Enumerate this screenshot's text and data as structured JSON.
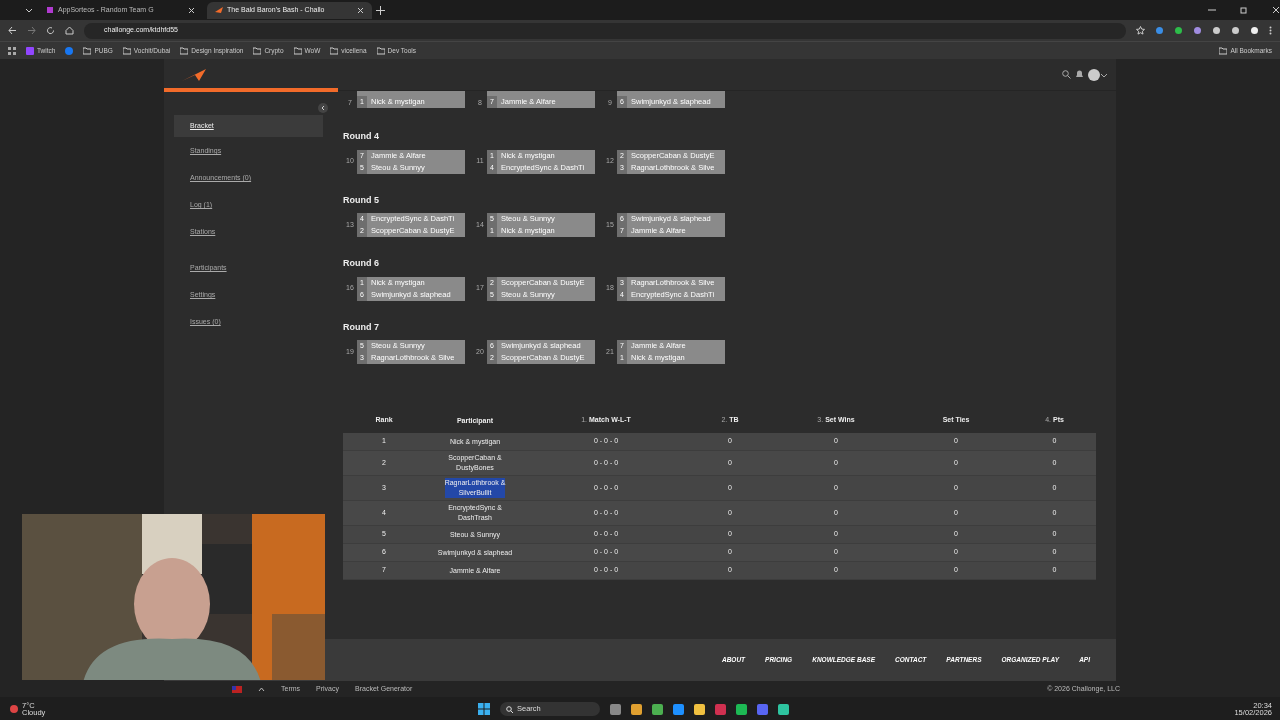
{
  "browser": {
    "tabs": [
      {
        "label": "AppSorteos - Random Team G",
        "selected": false
      },
      {
        "label": "The Bald Baron's Bash - Challo",
        "selected": true
      }
    ],
    "url": "challonge.com/ktdhfd55",
    "bookmarks": [
      {
        "label": "Twitch",
        "kind": "twitch"
      },
      {
        "kind": "facebook"
      },
      {
        "label": "PUBG",
        "kind": "folder"
      },
      {
        "label": "Vochit/Dubai",
        "kind": "folder"
      },
      {
        "label": "Design Inspiration",
        "kind": "folder"
      },
      {
        "label": "Crypto",
        "kind": "folder"
      },
      {
        "label": "WoW",
        "kind": "folder"
      },
      {
        "label": "vicellena",
        "kind": "folder"
      },
      {
        "label": "Dev Tools",
        "kind": "folder"
      }
    ],
    "all_bookmarks": "All Bookmarks"
  },
  "sidebar": {
    "items": [
      {
        "label": "Bracket",
        "selected": true
      },
      {
        "label": "Standings",
        "selected": false
      },
      {
        "label": "Announcements (0)",
        "selected": false
      },
      {
        "label": "Log (1)",
        "selected": false
      },
      {
        "label": "Stations",
        "selected": false
      },
      {
        "label": "Participants",
        "selected": false
      },
      {
        "label": "Settings",
        "selected": false
      },
      {
        "label": "Issues (0)",
        "selected": false
      }
    ]
  },
  "partial_round": {
    "matches": [
      {
        "number": "7",
        "seed": "1",
        "player": "Nick & mystigan"
      },
      {
        "number": "8",
        "seed": "7",
        "player": "Jammie & Alfare"
      },
      {
        "number": "9",
        "seed": "6",
        "player": "Swimjunkyd & slaphead"
      }
    ]
  },
  "rounds": [
    {
      "title": "Round 4",
      "matches": [
        {
          "number": "10",
          "players": [
            {
              "seed": "7",
              "name": "Jammie & Alfare"
            },
            {
              "seed": "5",
              "name": "Steou & Sunnyy"
            }
          ]
        },
        {
          "number": "11",
          "players": [
            {
              "seed": "1",
              "name": "Nick & mystigan"
            },
            {
              "seed": "4",
              "name": "EncryptedSync & DashTi"
            }
          ]
        },
        {
          "number": "12",
          "players": [
            {
              "seed": "2",
              "name": "ScopperCaban & DustyE"
            },
            {
              "seed": "3",
              "name": "RagnarLothbrook & Silve"
            }
          ]
        }
      ]
    },
    {
      "title": "Round 5",
      "matches": [
        {
          "number": "13",
          "players": [
            {
              "seed": "4",
              "name": "EncryptedSync & DashTi"
            },
            {
              "seed": "2",
              "name": "ScopperCaban & DustyE"
            }
          ]
        },
        {
          "number": "14",
          "players": [
            {
              "seed": "5",
              "name": "Steou & Sunnyy"
            },
            {
              "seed": "1",
              "name": "Nick & mystigan"
            }
          ]
        },
        {
          "number": "15",
          "players": [
            {
              "seed": "6",
              "name": "Swimjunkyd & slaphead"
            },
            {
              "seed": "7",
              "name": "Jammie & Alfare"
            }
          ]
        }
      ]
    },
    {
      "title": "Round 6",
      "matches": [
        {
          "number": "16",
          "players": [
            {
              "seed": "1",
              "name": "Nick & mystigan"
            },
            {
              "seed": "6",
              "name": "Swimjunkyd & slaphead"
            }
          ]
        },
        {
          "number": "17",
          "players": [
            {
              "seed": "2",
              "name": "ScopperCaban & DustyE"
            },
            {
              "seed": "5",
              "name": "Steou & Sunnyy"
            }
          ]
        },
        {
          "number": "18",
          "players": [
            {
              "seed": "3",
              "name": "RagnarLothbrook & Silve"
            },
            {
              "seed": "4",
              "name": "EncryptedSync & DashTi"
            }
          ]
        }
      ]
    },
    {
      "title": "Round 7",
      "matches": [
        {
          "number": "19",
          "players": [
            {
              "seed": "5",
              "name": "Steou & Sunnyy"
            },
            {
              "seed": "3",
              "name": "RagnarLothbrook & Silve"
            }
          ]
        },
        {
          "number": "20",
          "players": [
            {
              "seed": "6",
              "name": "Swimjunkyd & slaphead"
            },
            {
              "seed": "2",
              "name": "ScopperCaban & DustyE"
            }
          ]
        },
        {
          "number": "21",
          "players": [
            {
              "seed": "7",
              "name": "Jammie & Alfare"
            },
            {
              "seed": "1",
              "name": "Nick & mystigan"
            }
          ]
        }
      ]
    }
  ],
  "standings": {
    "columns": [
      {
        "label": "Rank"
      },
      {
        "label": "Participant"
      },
      {
        "index": "1.",
        "label": "Match W-L-T"
      },
      {
        "index": "2.",
        "label": "TB"
      },
      {
        "index": "3.",
        "label": "Set Wins"
      },
      {
        "label": "Set Ties"
      },
      {
        "index": "4.",
        "label": "Pts"
      }
    ],
    "rows": [
      {
        "rank": "1",
        "participant": [
          "Nick & mystigan"
        ],
        "highlighted": false,
        "match": "0 - 0 - 0",
        "tb": "0",
        "set_wins": "0",
        "set_ties": "0",
        "pts": "0"
      },
      {
        "rank": "2",
        "participant": [
          "ScopperCaban &",
          "DustyBones"
        ],
        "highlighted": false,
        "match": "0 - 0 - 0",
        "tb": "0",
        "set_wins": "0",
        "set_ties": "0",
        "pts": "0"
      },
      {
        "rank": "3",
        "participant": [
          "RagnarLothbrook &",
          "SilverBullit"
        ],
        "highlighted": true,
        "match": "0 - 0 - 0",
        "tb": "0",
        "set_wins": "0",
        "set_ties": "0",
        "pts": "0"
      },
      {
        "rank": "4",
        "participant": [
          "EncryptedSync &",
          "DashTrash"
        ],
        "highlighted": false,
        "match": "0 - 0 - 0",
        "tb": "0",
        "set_wins": "0",
        "set_ties": "0",
        "pts": "0"
      },
      {
        "rank": "5",
        "participant": [
          "Steou & Sunnyy"
        ],
        "highlighted": false,
        "match": "0 - 0 - 0",
        "tb": "0",
        "set_wins": "0",
        "set_ties": "0",
        "pts": "0"
      },
      {
        "rank": "6",
        "participant": [
          "Swimjunkyd & slaphead"
        ],
        "highlighted": false,
        "match": "0 - 0 - 0",
        "tb": "0",
        "set_wins": "0",
        "set_ties": "0",
        "pts": "0"
      },
      {
        "rank": "7",
        "participant": [
          "Jammie & Alfare"
        ],
        "highlighted": false,
        "match": "0 - 0 - 0",
        "tb": "0",
        "set_wins": "0",
        "set_ties": "0",
        "pts": "0"
      }
    ]
  },
  "footer": {
    "links": [
      "ABOUT",
      "PRICING",
      "KNOWLEDGE BASE",
      "CONTACT",
      "PARTNERS",
      "ORGANIZED PLAY",
      "API"
    ],
    "legal": [
      "Terms",
      "Privacy",
      "Bracket Generator"
    ],
    "copyright": "© 2026 Challonge, LLC"
  },
  "taskbar": {
    "temperature": "7°C",
    "weather": "Cloudy",
    "search": "Search",
    "time": "20:34",
    "date": "15/02/2026"
  }
}
